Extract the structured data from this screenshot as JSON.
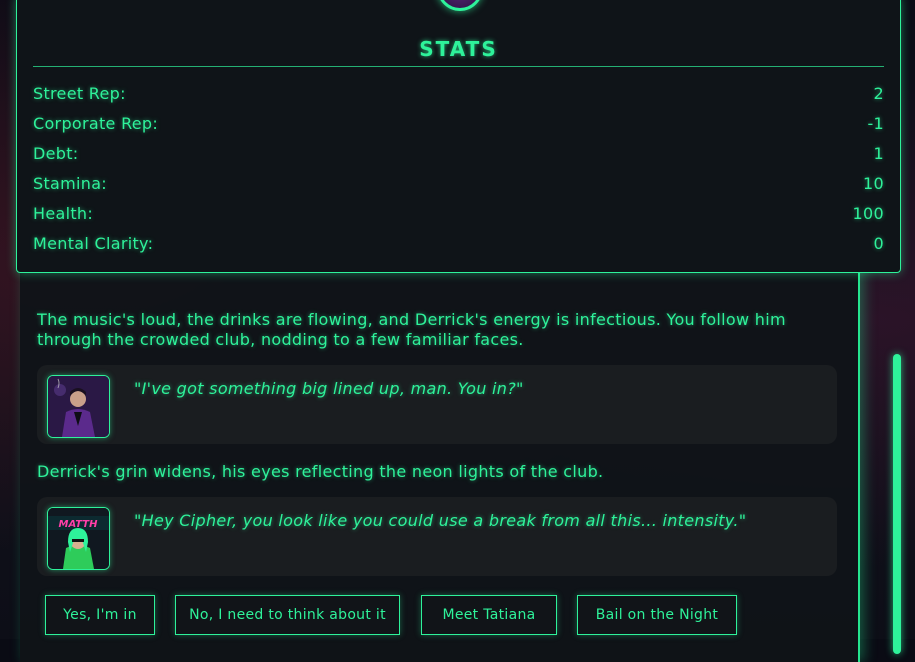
{
  "stats": {
    "title": "STATS",
    "rows": [
      {
        "label": "Street Rep:",
        "value": "2"
      },
      {
        "label": "Corporate Rep:",
        "value": "-1"
      },
      {
        "label": "Debt:",
        "value": "1"
      },
      {
        "label": "Stamina:",
        "value": "10"
      },
      {
        "label": "Health:",
        "value": "100"
      },
      {
        "label": "Mental Clarity:",
        "value": "0"
      }
    ]
  },
  "story": {
    "narration_1": "The music's loud, the drinks are flowing, and Derrick's energy is infectious. You follow him through the crowded club, nodding to a few familiar faces.",
    "dialog_1": "\"I've got something big lined up, man. You in?\"",
    "narration_2": "Derrick's grin widens, his eyes reflecting the neon lights of the club.",
    "dialog_2": "\"Hey Cipher, you look like you could use a break from all this... intensity.\"",
    "portrait_2_text": "MATTH"
  },
  "choices": [
    "Yes, I'm in",
    "No, I need to think about it",
    "Meet Tatiana",
    "Bail on the Night"
  ],
  "colors": {
    "accent": "#2ef29a",
    "panel": "#0f1418",
    "card": "#1a1d20"
  }
}
